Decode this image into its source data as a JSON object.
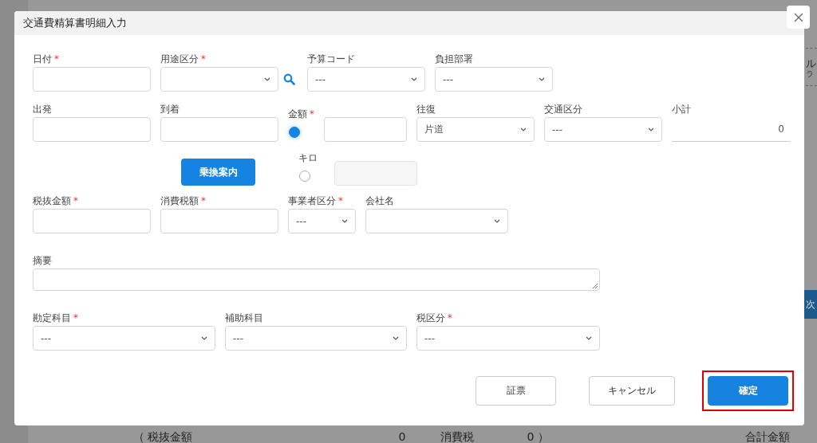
{
  "background": {
    "side_tab": "ル",
    "side_tab_sub": "ラ",
    "next_button": "次",
    "summary": [
      "（ 税抜金額",
      "0",
      "消費税",
      "0 ）",
      "合計金額"
    ]
  },
  "dialog": {
    "title": "交通費精算書明細入力",
    "rows": [
      [
        {
          "kind": "text",
          "label": "日付",
          "required_mark": "*"
        },
        {
          "kind": "select",
          "label": "用途区分",
          "required_mark": "*",
          "search_button": true
        },
        {
          "kind": "select",
          "label": "予算コード",
          "value": "---"
        },
        {
          "kind": "select",
          "label": "負担部署",
          "value": "---"
        }
      ],
      [
        {
          "kind": "text",
          "label": "出発"
        },
        {
          "kind": "text",
          "label": "到着"
        },
        {
          "kind": "radio_input",
          "label": "金額",
          "required_mark": "*",
          "selected": true,
          "disabled": false
        },
        {
          "kind": "select",
          "label": "往復",
          "value": "片道"
        },
        {
          "kind": "select",
          "label": "交通区分",
          "value": "---"
        },
        {
          "kind": "readout",
          "label": "小計",
          "value": "0"
        }
      ],
      [
        {
          "kind": "button",
          "label": "乗換案内"
        },
        {
          "kind": "radio_input",
          "label": "キロ",
          "selected": false,
          "disabled": true
        }
      ],
      [
        {
          "kind": "text",
          "label": "税抜金額",
          "required_mark": "*"
        },
        {
          "kind": "text",
          "label": "消費税額",
          "required_mark": "*"
        },
        {
          "kind": "select",
          "label": "事業者区分",
          "required_mark": "*",
          "value": "---"
        },
        {
          "kind": "select",
          "label": "会社名"
        }
      ],
      [
        {
          "kind": "textarea",
          "label": "摘要"
        }
      ],
      [
        {
          "kind": "select",
          "label": "勘定科目",
          "required_mark": "*",
          "value": "---"
        },
        {
          "kind": "select",
          "label": "補助科目",
          "value": "---"
        },
        {
          "kind": "select",
          "label": "税区分",
          "required_mark": "*",
          "value": "---"
        }
      ]
    ],
    "buttons": [
      {
        "label": "証票",
        "primary": false,
        "highlighted": false
      },
      {
        "label": "キャンセル",
        "primary": false,
        "highlighted": false
      },
      {
        "label": "確定",
        "primary": true,
        "highlighted": true
      }
    ]
  }
}
